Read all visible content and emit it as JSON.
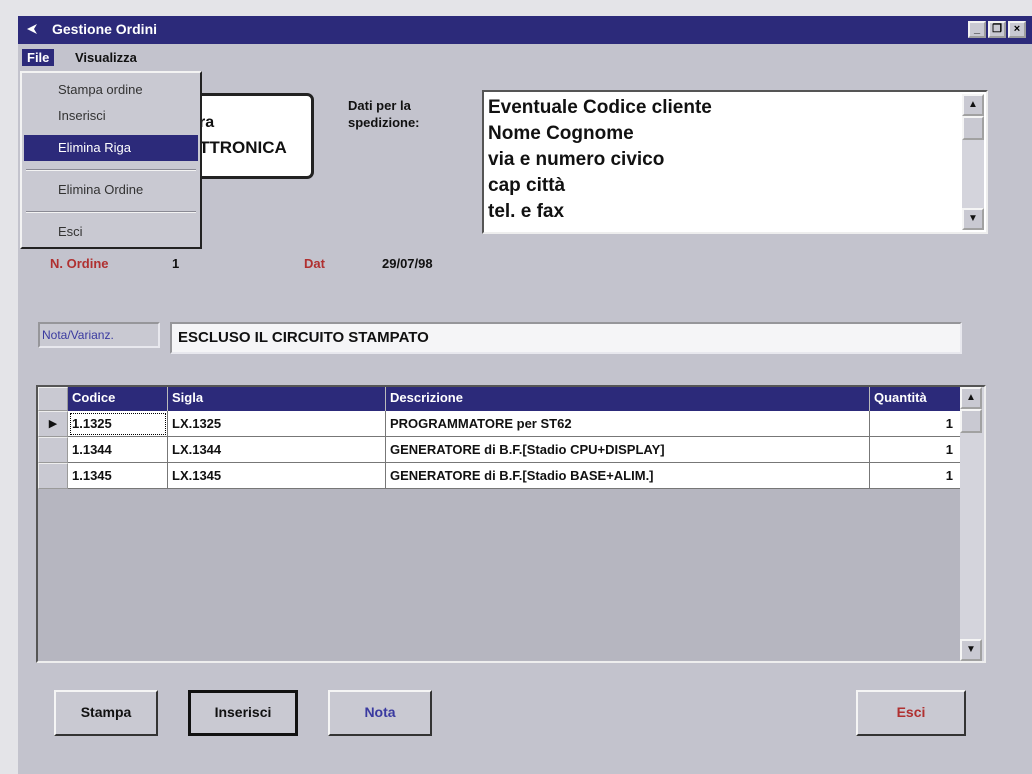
{
  "window": {
    "title": "Gestione Ordini",
    "controls": {
      "minimize": "_",
      "maximize": "❐",
      "close": "×"
    }
  },
  "menubar": {
    "items": [
      "File",
      "Visualizza"
    ],
    "active": "File"
  },
  "file_menu": {
    "items": [
      "Stampa ordine",
      "Inserisci",
      "Elimina Riga",
      "Elimina Ordine",
      "Esci"
    ],
    "selected": "Elimina Riga"
  },
  "logo": {
    "line1": "ra",
    "line2": "TTRONICA"
  },
  "shipping": {
    "label_line1": "Dati per la",
    "label_line2": "spedizione:",
    "lines": [
      "Eventuale Codice cliente",
      "Nome Cognome",
      "via e numero civico",
      "cap città",
      "tel. e fax"
    ]
  },
  "order": {
    "number_label": "N. Ordine",
    "number": "1",
    "date_label": "Dat",
    "date": "29/07/98"
  },
  "note": {
    "label": "Nota/Varianz.",
    "value": "ESCLUSO IL CIRCUITO STAMPATO"
  },
  "grid": {
    "columns": [
      "Codice",
      "Sigla",
      "Descrizione",
      "Quantità"
    ],
    "current_row_marker": "▶",
    "rows": [
      {
        "codice": "1.1325",
        "sigla": "LX.1325",
        "descrizione": "PROGRAMMATORE per ST62",
        "quantita": "1"
      },
      {
        "codice": "1.1344",
        "sigla": "LX.1344",
        "descrizione": "GENERATORE di B.F.[Stadio CPU+DISPLAY]",
        "quantita": "1"
      },
      {
        "codice": "1.1345",
        "sigla": "LX.1345",
        "descrizione": "GENERATORE di B.F.[Stadio BASE+ALIM.]",
        "quantita": "1"
      }
    ]
  },
  "buttons": {
    "stampa": "Stampa",
    "inserisci": "Inserisci",
    "nota": "Nota",
    "esci": "Esci"
  },
  "colors": {
    "titlebar": "#2c2a7a",
    "window_bg": "#c3c3cd",
    "label_red": "#b03030",
    "note_label_text": "#3a3aa0",
    "nota_button_text": "#3a3aa0",
    "esci_button_text": "#b03030"
  },
  "icons": {
    "scroll_up": "▲",
    "scroll_down": "▼"
  }
}
